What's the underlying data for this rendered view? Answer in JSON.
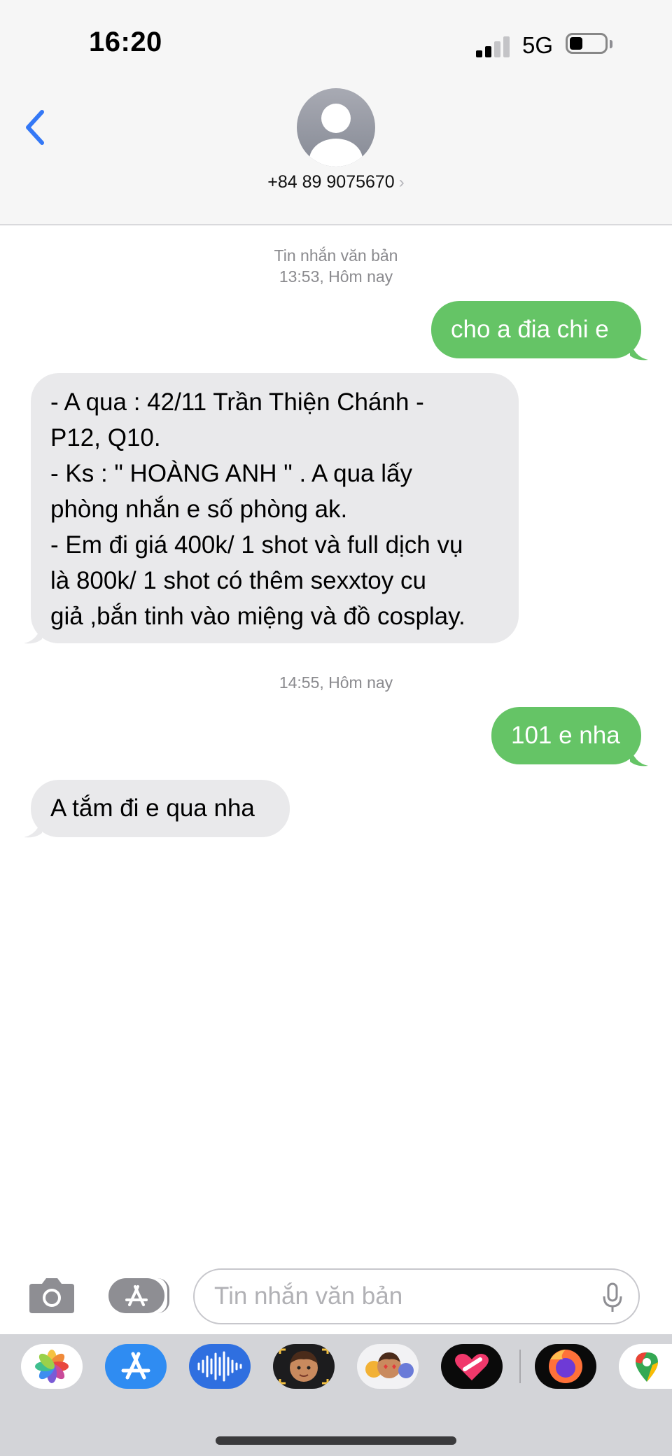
{
  "status_bar": {
    "time": "16:20",
    "network": "5G"
  },
  "header": {
    "contact": "+84 89 9075670",
    "chevron": "›"
  },
  "conversation": [
    {
      "kind": "stamp",
      "lines": [
        "Tin nhắn văn bản",
        "13:53, Hôm nay"
      ]
    },
    {
      "kind": "outgoing",
      "lines": [
        "cho a đia chi e"
      ]
    },
    {
      "kind": "incoming",
      "lines": [
        "- A qua : 42/11 Trần Thiện Chánh -",
        "P12, Q10.",
        "- Ks : \" HOÀNG ANH \" . A qua lấy",
        "phòng nhắn e số phòng ak.",
        "- Em đi giá 400k/ 1 shot và full dịch vụ",
        "là 800k/ 1 shot có thêm sexxtoy cu",
        "giả ,bắn tinh vào miệng và đồ cosplay."
      ]
    },
    {
      "kind": "stamp",
      "lines": [
        "14:55, Hôm nay"
      ]
    },
    {
      "kind": "outgoing",
      "lines": [
        "101 e nha"
      ]
    },
    {
      "kind": "incoming",
      "lines": [
        "A tắm đi e qua nha"
      ]
    }
  ],
  "composer": {
    "placeholder": "Tin nhắn văn bản",
    "camera_icon": "camera-icon",
    "apps_icon": "app-store-icon",
    "mic_icon": "microphone-icon"
  },
  "app_strip": [
    {
      "name": "photos-app-icon"
    },
    {
      "name": "app-store-app-icon"
    },
    {
      "name": "audio-message-app-icon"
    },
    {
      "name": "memoji-app-icon"
    },
    {
      "name": "animoji-stickers-app-icon"
    },
    {
      "name": "digital-touch-app-icon"
    },
    {
      "name": "firefox-app-icon"
    },
    {
      "name": "google-maps-app-icon"
    }
  ],
  "colors": {
    "outgoing_bubble": "#65c466",
    "incoming_bubble": "#e9e9eb",
    "accent_blue": "#3478f6"
  }
}
